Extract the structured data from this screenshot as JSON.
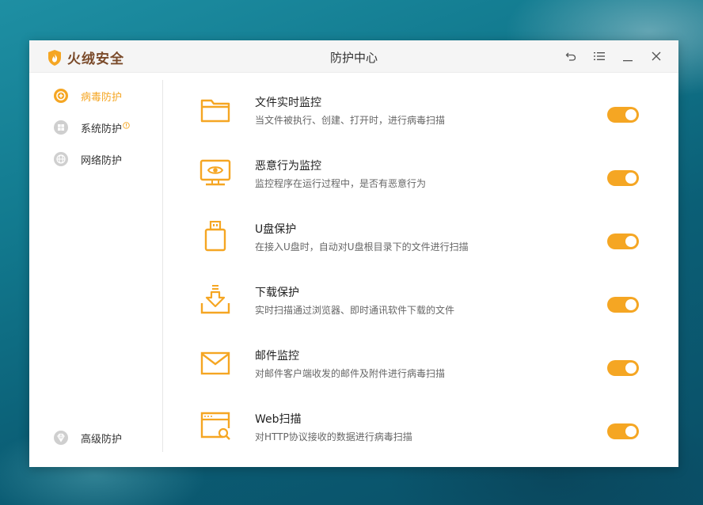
{
  "app": {
    "brand": "火绒安全",
    "window_title": "防护中心",
    "accent_color": "#f5a623"
  },
  "titlebar": {
    "controls": [
      {
        "name": "back-icon"
      },
      {
        "name": "menu-icon"
      },
      {
        "name": "minimize-icon"
      },
      {
        "name": "close-icon"
      }
    ]
  },
  "sidebar": {
    "items": [
      {
        "label": "病毒防护",
        "icon": "virus-protection-icon",
        "active": true
      },
      {
        "label": "系统防护",
        "icon": "windows-icon",
        "active": false,
        "badge": "info-badge-icon"
      },
      {
        "label": "网络防护",
        "icon": "globe-icon",
        "active": false
      },
      {
        "label": "高级防护",
        "icon": "diamond-icon",
        "active": false
      }
    ]
  },
  "features": [
    {
      "title": "文件实时监控",
      "desc": "当文件被执行、创建、打开时，进行病毒扫描",
      "icon": "folder-icon",
      "enabled": true
    },
    {
      "title": "恶意行为监控",
      "desc": "监控程序在运行过程中，是否有恶意行为",
      "icon": "monitor-eye-icon",
      "enabled": true
    },
    {
      "title": "U盘保护",
      "desc": "在接入U盘时，自动对U盘根目录下的文件进行扫描",
      "icon": "usb-drive-icon",
      "enabled": true
    },
    {
      "title": "下载保护",
      "desc": "实时扫描通过浏览器、即时通讯软件下载的文件",
      "icon": "download-icon",
      "enabled": true
    },
    {
      "title": "邮件监控",
      "desc": "对邮件客户端收发的邮件及附件进行病毒扫描",
      "icon": "mail-icon",
      "enabled": true
    },
    {
      "title": "Web扫描",
      "desc": "对HTTP协议接收的数据进行病毒扫描",
      "icon": "web-scan-icon",
      "enabled": true
    }
  ]
}
